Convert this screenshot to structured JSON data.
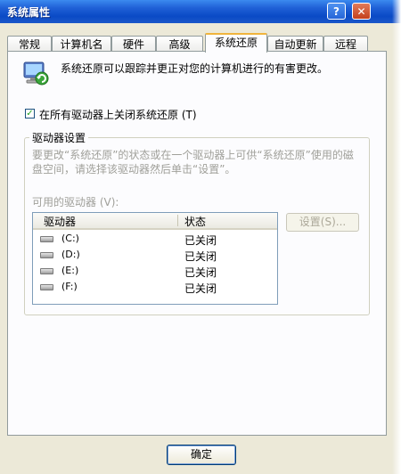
{
  "window": {
    "title": "系统属性"
  },
  "titlebar": {
    "help_label": "?",
    "close_label": "✕"
  },
  "tabs": [
    {
      "label": "常规"
    },
    {
      "label": "计算机名"
    },
    {
      "label": "硬件"
    },
    {
      "label": "高级"
    },
    {
      "label": "系统还原",
      "active": true
    },
    {
      "label": "自动更新"
    },
    {
      "label": "远程"
    }
  ],
  "panel": {
    "intro_text": "系统还原可以跟踪并更正对您的计算机进行的有害更改。",
    "disable_checkbox": {
      "label": "在所有驱动器上关闭系统还原 (T)",
      "checked": true
    },
    "group": {
      "title": "驱动器设置",
      "hint": "要更改“系统还原”的状态或在一个驱动器上可供“系统还原”使用的磁盘空间，请选择该驱动器然后单击“设置”。",
      "available_label": "可用的驱动器 (V):",
      "columns": {
        "drive": "驱动器",
        "status": "状态"
      },
      "drives": [
        {
          "name": "(C:)",
          "status": "已关闭"
        },
        {
          "name": "(D:)",
          "status": "已关闭"
        },
        {
          "name": "(E:)",
          "status": "已关闭"
        },
        {
          "name": "(F:)",
          "status": "已关闭"
        }
      ],
      "settings_button": "设置(S)..."
    }
  },
  "footer": {
    "ok_label": "确定"
  },
  "icons": {
    "system_restore": "system-restore-icon",
    "drive": "drive-icon",
    "help": "help-icon",
    "close": "close-icon"
  },
  "colors": {
    "title_bar": "#0a4ac6",
    "active_tab_accent": "#f0b43c",
    "dialog_bg": "#ece9d8"
  }
}
